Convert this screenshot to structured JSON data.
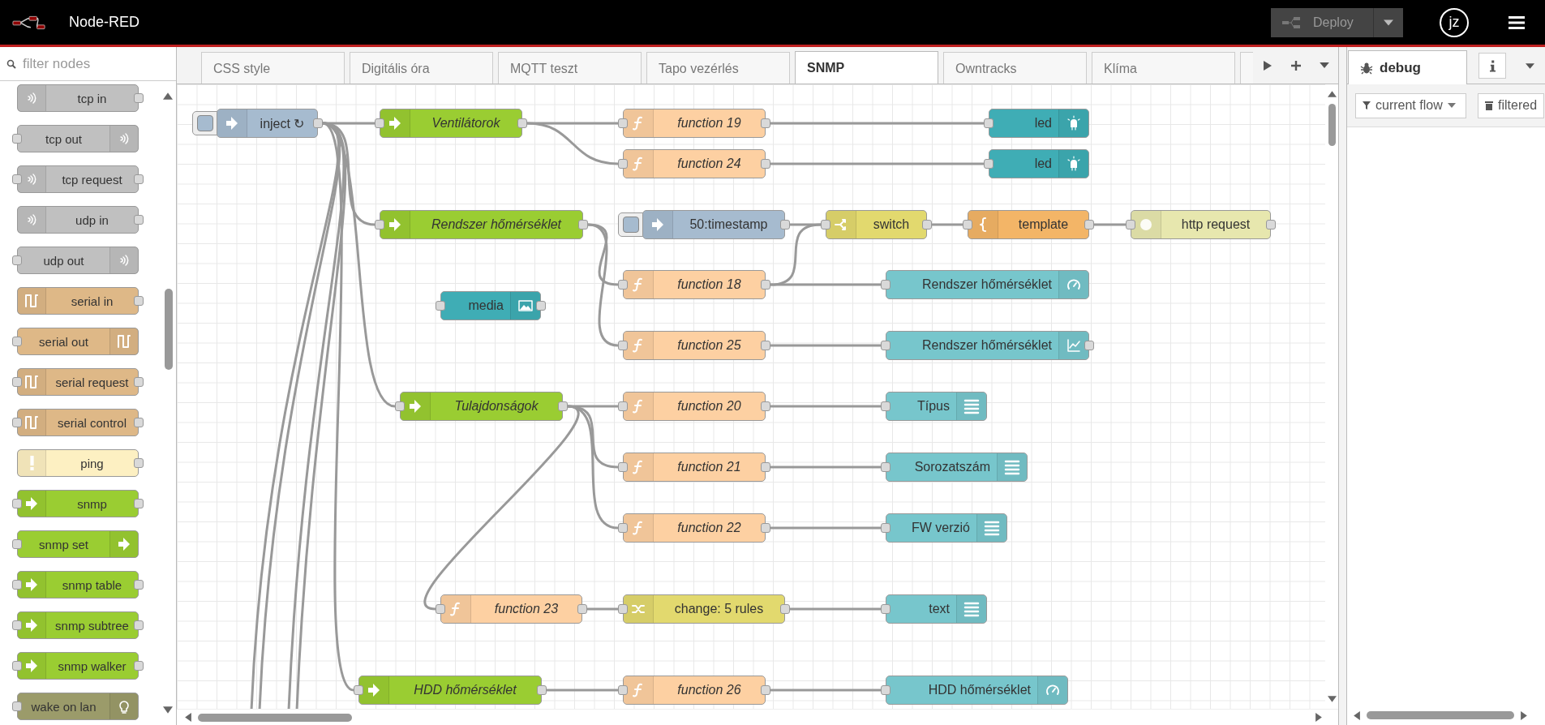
{
  "header": {
    "title": "Node-RED",
    "deploy": "Deploy",
    "user": "jz"
  },
  "palette": {
    "filter_placeholder": "filter nodes",
    "nodes": [
      {
        "label": "tcp in",
        "kind": "net_in"
      },
      {
        "label": "tcp out",
        "kind": "net_out"
      },
      {
        "label": "tcp request",
        "kind": "net_req"
      },
      {
        "label": "udp in",
        "kind": "net_in"
      },
      {
        "label": "udp out",
        "kind": "net_out"
      },
      {
        "label": "serial in",
        "kind": "serial_in"
      },
      {
        "label": "serial out",
        "kind": "serial_out"
      },
      {
        "label": "serial request",
        "kind": "serial_req"
      },
      {
        "label": "serial control",
        "kind": "serial_req"
      },
      {
        "label": "ping",
        "kind": "ping"
      },
      {
        "label": "snmp",
        "kind": "snmp"
      },
      {
        "label": "snmp set",
        "kind": "snmp_set"
      },
      {
        "label": "snmp table",
        "kind": "snmp"
      },
      {
        "label": "snmp subtree",
        "kind": "snmp"
      },
      {
        "label": "snmp walker",
        "kind": "snmp"
      },
      {
        "label": "wake on lan",
        "kind": "wol"
      }
    ]
  },
  "tabs": [
    {
      "label": "CSS style",
      "selected": false
    },
    {
      "label": "Digitális óra",
      "selected": false
    },
    {
      "label": "MQTT teszt",
      "selected": false
    },
    {
      "label": "Tapo vezérlés",
      "selected": false
    },
    {
      "label": "SNMP",
      "selected": true
    },
    {
      "label": "Owntracks",
      "selected": false
    },
    {
      "label": "Klíma",
      "selected": false
    }
  ],
  "flow": {
    "nodes": [
      {
        "label": "inject ↻",
        "kind": "inject"
      },
      {
        "label": "Ventilátorok",
        "kind": "snmp"
      },
      {
        "label": "function 19",
        "kind": "function"
      },
      {
        "label": "function 24",
        "kind": "function"
      },
      {
        "label": "led",
        "kind": "led"
      },
      {
        "label": "led",
        "kind": "led"
      },
      {
        "label": "Rendszer hőmérséklet",
        "kind": "snmp"
      },
      {
        "label": "50:timestamp",
        "kind": "inject"
      },
      {
        "label": "switch",
        "kind": "switch"
      },
      {
        "label": "template",
        "kind": "template"
      },
      {
        "label": "http request",
        "kind": "http"
      },
      {
        "label": "media",
        "kind": "media"
      },
      {
        "label": "function 18",
        "kind": "function"
      },
      {
        "label": "Rendszer hőmérséklet",
        "kind": "gauge"
      },
      {
        "label": "function 25",
        "kind": "function"
      },
      {
        "label": "Rendszer hőmérséklet",
        "kind": "chart"
      },
      {
        "label": "Tulajdonságok",
        "kind": "snmp"
      },
      {
        "label": "function 20",
        "kind": "function"
      },
      {
        "label": "Típus",
        "kind": "ui_text"
      },
      {
        "label": "function 21",
        "kind": "function"
      },
      {
        "label": "Sorozatszám",
        "kind": "ui_text"
      },
      {
        "label": "function 22",
        "kind": "function"
      },
      {
        "label": "FW verzió",
        "kind": "ui_text"
      },
      {
        "label": "function 23",
        "kind": "function"
      },
      {
        "label": "change: 5 rules",
        "kind": "change"
      },
      {
        "label": "text",
        "kind": "ui_text"
      },
      {
        "label": "HDD hőmérséklet",
        "kind": "snmp"
      },
      {
        "label": "function 26",
        "kind": "function"
      },
      {
        "label": "HDD hőmérséklet",
        "kind": "gauge"
      }
    ]
  },
  "sidebar": {
    "tabs": [
      {
        "kind": "debug",
        "label": "debug",
        "selected": true
      },
      {
        "kind": "info",
        "selected": false
      }
    ],
    "filter": "current flow",
    "clear": "filtered"
  }
}
